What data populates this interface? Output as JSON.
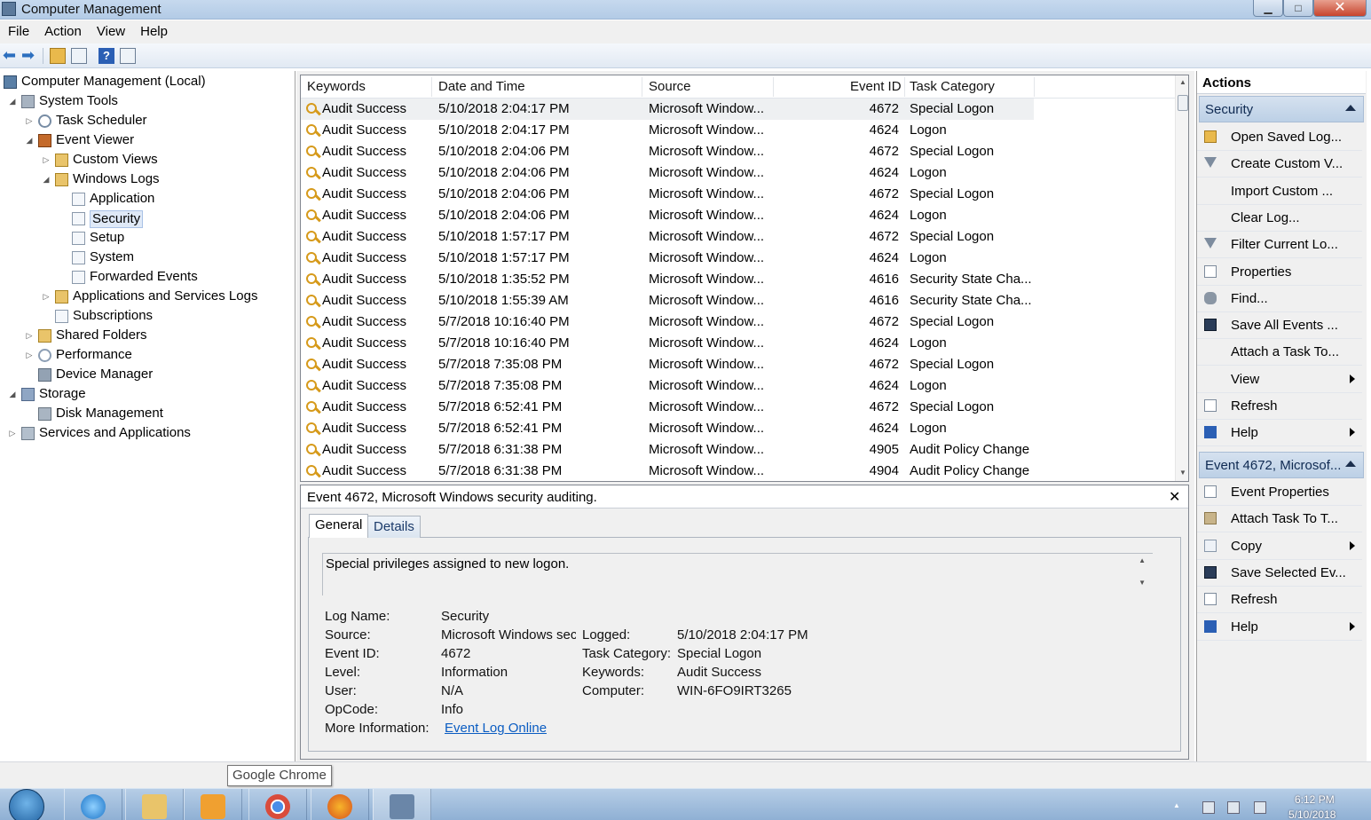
{
  "window": {
    "title": "Computer Management"
  },
  "menu": [
    "File",
    "Action",
    "View",
    "Help"
  ],
  "tree": [
    {
      "label": "Computer Management (Local)",
      "icon": "computer-icon"
    },
    {
      "label": "System Tools",
      "icon": "tools-icon"
    },
    {
      "label": "Task Scheduler",
      "icon": "clock-icon"
    },
    {
      "label": "Event Viewer",
      "icon": "event-viewer-icon"
    },
    {
      "label": "Custom Views",
      "icon": "folder-icon"
    },
    {
      "label": "Windows Logs",
      "icon": "folder-icon"
    },
    {
      "label": "Application",
      "icon": "log-icon"
    },
    {
      "label": "Security",
      "icon": "log-icon"
    },
    {
      "label": "Setup",
      "icon": "log-icon"
    },
    {
      "label": "System",
      "icon": "log-icon"
    },
    {
      "label": "Forwarded Events",
      "icon": "log-icon"
    },
    {
      "label": "Applications and Services Logs",
      "icon": "folder-icon"
    },
    {
      "label": "Subscriptions",
      "icon": "log-icon"
    },
    {
      "label": "Shared Folders",
      "icon": "shared-folders-icon"
    },
    {
      "label": "Performance",
      "icon": "performance-icon"
    },
    {
      "label": "Device Manager",
      "icon": "device-manager-icon"
    },
    {
      "label": "Storage",
      "icon": "storage-icon"
    },
    {
      "label": "Disk Management",
      "icon": "disk-icon"
    },
    {
      "label": "Services and Applications",
      "icon": "services-icon"
    }
  ],
  "events": {
    "columns": [
      "Keywords",
      "Date and Time",
      "Source",
      "Event ID",
      "Task Category"
    ],
    "rows": [
      {
        "kw": "Audit Success",
        "dt": "5/10/2018 2:04:17 PM",
        "src": "Microsoft Window...",
        "id": "4672",
        "cat": "Special Logon"
      },
      {
        "kw": "Audit Success",
        "dt": "5/10/2018 2:04:17 PM",
        "src": "Microsoft Window...",
        "id": "4624",
        "cat": "Logon"
      },
      {
        "kw": "Audit Success",
        "dt": "5/10/2018 2:04:06 PM",
        "src": "Microsoft Window...",
        "id": "4672",
        "cat": "Special Logon"
      },
      {
        "kw": "Audit Success",
        "dt": "5/10/2018 2:04:06 PM",
        "src": "Microsoft Window...",
        "id": "4624",
        "cat": "Logon"
      },
      {
        "kw": "Audit Success",
        "dt": "5/10/2018 2:04:06 PM",
        "src": "Microsoft Window...",
        "id": "4672",
        "cat": "Special Logon"
      },
      {
        "kw": "Audit Success",
        "dt": "5/10/2018 2:04:06 PM",
        "src": "Microsoft Window...",
        "id": "4624",
        "cat": "Logon"
      },
      {
        "kw": "Audit Success",
        "dt": "5/10/2018 1:57:17 PM",
        "src": "Microsoft Window...",
        "id": "4672",
        "cat": "Special Logon"
      },
      {
        "kw": "Audit Success",
        "dt": "5/10/2018 1:57:17 PM",
        "src": "Microsoft Window...",
        "id": "4624",
        "cat": "Logon"
      },
      {
        "kw": "Audit Success",
        "dt": "5/10/2018 1:35:52 PM",
        "src": "Microsoft Window...",
        "id": "4616",
        "cat": "Security State Cha..."
      },
      {
        "kw": "Audit Success",
        "dt": "5/10/2018 1:55:39 AM",
        "src": "Microsoft Window...",
        "id": "4616",
        "cat": "Security State Cha..."
      },
      {
        "kw": "Audit Success",
        "dt": "5/7/2018 10:16:40 PM",
        "src": "Microsoft Window...",
        "id": "4672",
        "cat": "Special Logon"
      },
      {
        "kw": "Audit Success",
        "dt": "5/7/2018 10:16:40 PM",
        "src": "Microsoft Window...",
        "id": "4624",
        "cat": "Logon"
      },
      {
        "kw": "Audit Success",
        "dt": "5/7/2018 7:35:08 PM",
        "src": "Microsoft Window...",
        "id": "4672",
        "cat": "Special Logon"
      },
      {
        "kw": "Audit Success",
        "dt": "5/7/2018 7:35:08 PM",
        "src": "Microsoft Window...",
        "id": "4624",
        "cat": "Logon"
      },
      {
        "kw": "Audit Success",
        "dt": "5/7/2018 6:52:41 PM",
        "src": "Microsoft Window...",
        "id": "4672",
        "cat": "Special Logon"
      },
      {
        "kw": "Audit Success",
        "dt": "5/7/2018 6:52:41 PM",
        "src": "Microsoft Window...",
        "id": "4624",
        "cat": "Logon"
      },
      {
        "kw": "Audit Success",
        "dt": "5/7/2018 6:31:38 PM",
        "src": "Microsoft Window...",
        "id": "4905",
        "cat": "Audit Policy Change"
      },
      {
        "kw": "Audit Success",
        "dt": "5/7/2018 6:31:38 PM",
        "src": "Microsoft Window...",
        "id": "4904",
        "cat": "Audit Policy Change"
      }
    ]
  },
  "detail": {
    "title": "Event 4672, Microsoft Windows security auditing.",
    "tabs": [
      "General",
      "Details"
    ],
    "description": "Special privileges assigned to new logon.",
    "fields": {
      "log_name_label": "Log Name:",
      "log_name": "Security",
      "source_label": "Source:",
      "source": "Microsoft Windows sec",
      "event_id_label": "Event ID:",
      "event_id": "4672",
      "level_label": "Level:",
      "level": "Information",
      "user_label": "User:",
      "user": "N/A",
      "opcode_label": "OpCode:",
      "opcode": "Info",
      "more_info_label": "More Information:",
      "more_info_link": "Event Log Online",
      "logged_label": "Logged:",
      "logged": "5/10/2018 2:04:17 PM",
      "task_category_label": "Task Category:",
      "task_category": "Special Logon",
      "keywords_label": "Keywords:",
      "keywords": "Audit Success",
      "computer_label": "Computer:",
      "computer": "WIN-6FO9IRT3265"
    }
  },
  "actions": {
    "title": "Actions",
    "section1": "Security",
    "items1": [
      {
        "label": "Open Saved Log...",
        "icon": "open-folder-icon",
        "sub": false
      },
      {
        "label": "Create Custom V...",
        "icon": "filter-icon",
        "sub": false
      },
      {
        "label": "Import Custom ...",
        "icon": "",
        "sub": false
      },
      {
        "label": "Clear Log...",
        "icon": "",
        "sub": false
      },
      {
        "label": "Filter Current Lo...",
        "icon": "filter-icon",
        "sub": false
      },
      {
        "label": "Properties",
        "icon": "properties-icon",
        "sub": false
      },
      {
        "label": "Find...",
        "icon": "binoculars-icon",
        "sub": false
      },
      {
        "label": "Save All Events ...",
        "icon": "save-icon",
        "sub": false
      },
      {
        "label": "Attach a Task To...",
        "icon": "",
        "sub": false
      },
      {
        "label": "View",
        "icon": "",
        "sub": true
      },
      {
        "label": "Refresh",
        "icon": "refresh-icon",
        "sub": false
      },
      {
        "label": "Help",
        "icon": "help-icon",
        "sub": true
      }
    ],
    "section2": "Event 4672, Microsof...",
    "items2": [
      {
        "label": "Event Properties",
        "icon": "properties-icon",
        "sub": false
      },
      {
        "label": "Attach Task To T...",
        "icon": "task-icon",
        "sub": false
      },
      {
        "label": "Copy",
        "icon": "copy-icon",
        "sub": true
      },
      {
        "label": "Save Selected Ev...",
        "icon": "save-icon",
        "sub": false
      },
      {
        "label": "Refresh",
        "icon": "refresh-icon",
        "sub": false
      },
      {
        "label": "Help",
        "icon": "help-icon",
        "sub": true
      }
    ]
  },
  "tooltip": "Google Chrome",
  "taskbar": {
    "apps": [
      "internet-explorer-icon",
      "file-explorer-icon",
      "media-player-icon",
      "chrome-icon",
      "firefox-icon",
      "computer-management-icon"
    ],
    "time": "6:12 PM",
    "date": "5/10/2018"
  }
}
